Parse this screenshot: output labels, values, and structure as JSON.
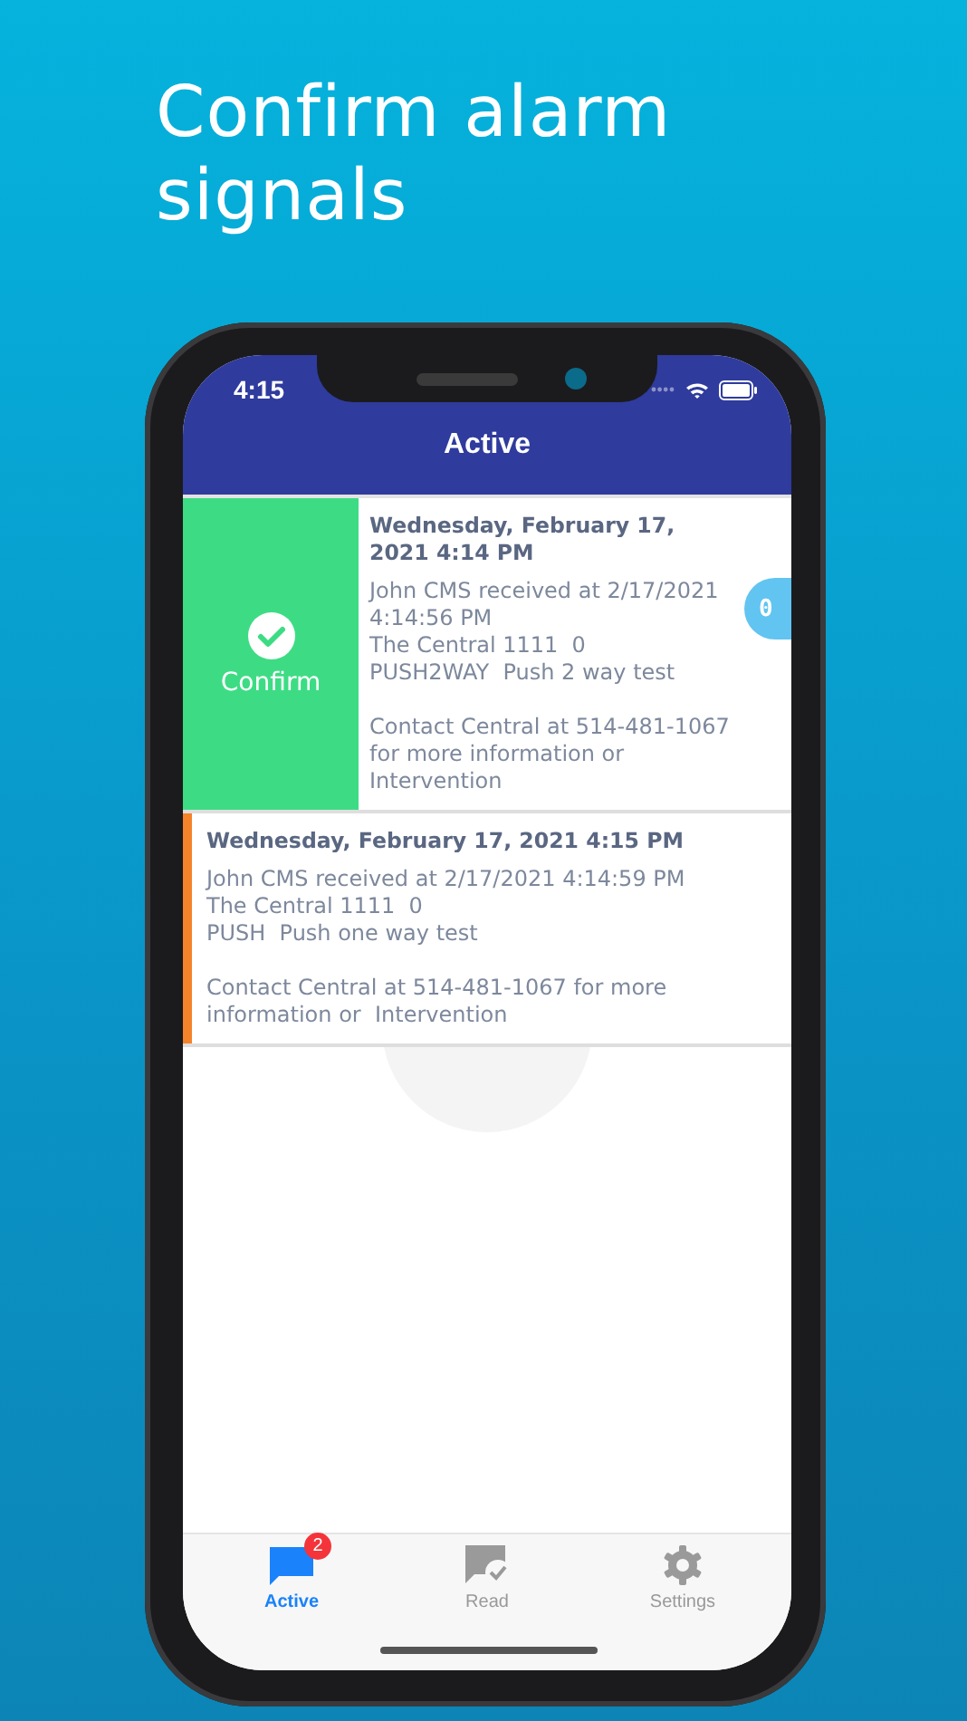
{
  "headline": "Confirm alarm signals",
  "status_bar": {
    "time": "4:15"
  },
  "nav": {
    "title": "Active"
  },
  "alerts": [
    {
      "swiped": true,
      "action": "Confirm",
      "side_badge": "0",
      "color": "#3ddc84",
      "date": "Wednesday, February 17, 2021 4:14 PM",
      "lines": [
        "John CMS received at 2/17/2021 4:14:56 PM",
        "The Central 1111  0",
        "PUSH2WAY  Push 2 way test"
      ],
      "contact": "Contact Central at 514-481-1067 for more information or  Intervention"
    },
    {
      "swiped": false,
      "color": "#f5832a",
      "date": "Wednesday, February 17, 2021 4:15 PM",
      "lines": [
        "John CMS received at 2/17/2021 4:14:59 PM",
        "The Central 1111  0",
        "PUSH  Push one way test"
      ],
      "contact": "Contact Central at 514-481-1067 for more information or  Intervention"
    }
  ],
  "tabs": [
    {
      "kind": "active",
      "label": "Active",
      "selected": true,
      "badge": "2"
    },
    {
      "kind": "read",
      "label": "Read",
      "selected": false
    },
    {
      "kind": "settings",
      "label": "Settings",
      "selected": false
    }
  ]
}
